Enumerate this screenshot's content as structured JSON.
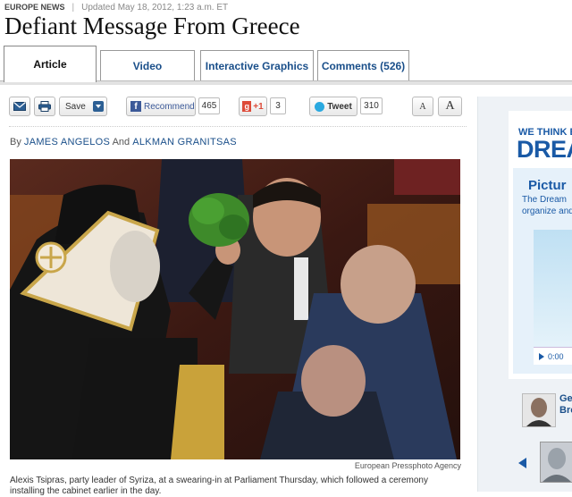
{
  "meta": {
    "section": "EUROPE NEWS",
    "updated": "Updated May 18, 2012, 1:23 a.m. ET"
  },
  "headline": "Defiant Message From Greece",
  "tabs": [
    {
      "label": "Article",
      "active": true
    },
    {
      "label": "Video",
      "active": false
    },
    {
      "label": "Interactive Graphics",
      "active": false
    },
    {
      "label": "Comments (526)",
      "active": false
    }
  ],
  "toolbar": {
    "email_icon": "envelope-icon",
    "print_icon": "printer-icon",
    "save_label": "Save",
    "recommend_label": "Recommend",
    "recommend_count": "465",
    "gplus_label": "+1",
    "gplus_count": "3",
    "tweet_label": "Tweet",
    "tweet_count": "310",
    "font_small": "A",
    "font_large": "A"
  },
  "byline": {
    "prefix": "By",
    "author1": "JAMES ANGELOS",
    "conj": "And",
    "author2": "ALKMAN GRANITSAS"
  },
  "photo": {
    "credit": "European Pressphoto Agency",
    "caption": "Alexis Tsipras, party leader of Syriza, at a swearing-in at Parliament Thursday, which followed a ceremony installing the cabinet earlier in the day."
  },
  "ad": {
    "line1": "WE THINK BE",
    "line2": "DREA",
    "line3": "Pictur",
    "line4": "The Dream",
    "line5": "organize and",
    "player_time": "0:00"
  },
  "sidebar": {
    "person_name_line1": "Ge",
    "person_name_line2": "Bro"
  },
  "colors": {
    "link": "#1a4f8a",
    "ad_blue": "#1a5aa6",
    "facebook": "#3b5998",
    "google": "#dd4b39",
    "twitter": "#2aa9e0"
  }
}
